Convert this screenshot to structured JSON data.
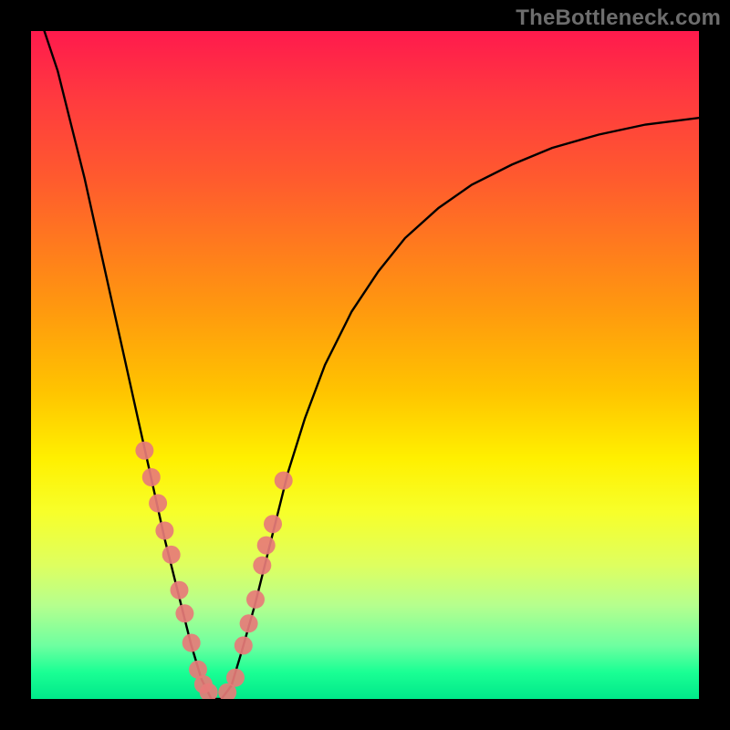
{
  "watermark": "TheBottleneck.com",
  "chart_data": {
    "type": "line",
    "title": "",
    "xlabel": "",
    "ylabel": "",
    "xlim": [
      0,
      1
    ],
    "ylim": [
      0,
      1
    ],
    "series": [
      {
        "name": "bottleneck-curve",
        "x": [
          0.02,
          0.04,
          0.06,
          0.08,
          0.1,
          0.12,
          0.14,
          0.16,
          0.18,
          0.2,
          0.22,
          0.24,
          0.255,
          0.27,
          0.285,
          0.3,
          0.315,
          0.335,
          0.36,
          0.385,
          0.41,
          0.44,
          0.48,
          0.52,
          0.56,
          0.61,
          0.66,
          0.72,
          0.78,
          0.85,
          0.92,
          1.0
        ],
        "values": [
          1.0,
          0.94,
          0.86,
          0.78,
          0.69,
          0.6,
          0.51,
          0.42,
          0.33,
          0.24,
          0.16,
          0.08,
          0.03,
          0.0,
          0.0,
          0.02,
          0.07,
          0.14,
          0.24,
          0.34,
          0.42,
          0.5,
          0.58,
          0.64,
          0.69,
          0.735,
          0.77,
          0.8,
          0.825,
          0.845,
          0.86,
          0.87
        ]
      }
    ],
    "markers": {
      "name": "highlighted-points",
      "x": [
        0.17,
        0.18,
        0.19,
        0.2,
        0.21,
        0.222,
        0.23,
        0.24,
        0.25,
        0.258,
        0.266,
        0.294,
        0.306,
        0.318,
        0.326,
        0.336,
        0.346,
        0.352,
        0.362,
        0.378
      ],
      "values": [
        0.372,
        0.332,
        0.293,
        0.252,
        0.216,
        0.163,
        0.128,
        0.084,
        0.044,
        0.022,
        0.01,
        0.01,
        0.032,
        0.08,
        0.113,
        0.149,
        0.2,
        0.23,
        0.262,
        0.327
      ]
    },
    "gradient_stops": [
      {
        "pos": 0.0,
        "color": "#ff1a4d"
      },
      {
        "pos": 0.5,
        "color": "#ffd000"
      },
      {
        "pos": 0.8,
        "color": "#deff60"
      },
      {
        "pos": 1.0,
        "color": "#00e88a"
      }
    ]
  }
}
